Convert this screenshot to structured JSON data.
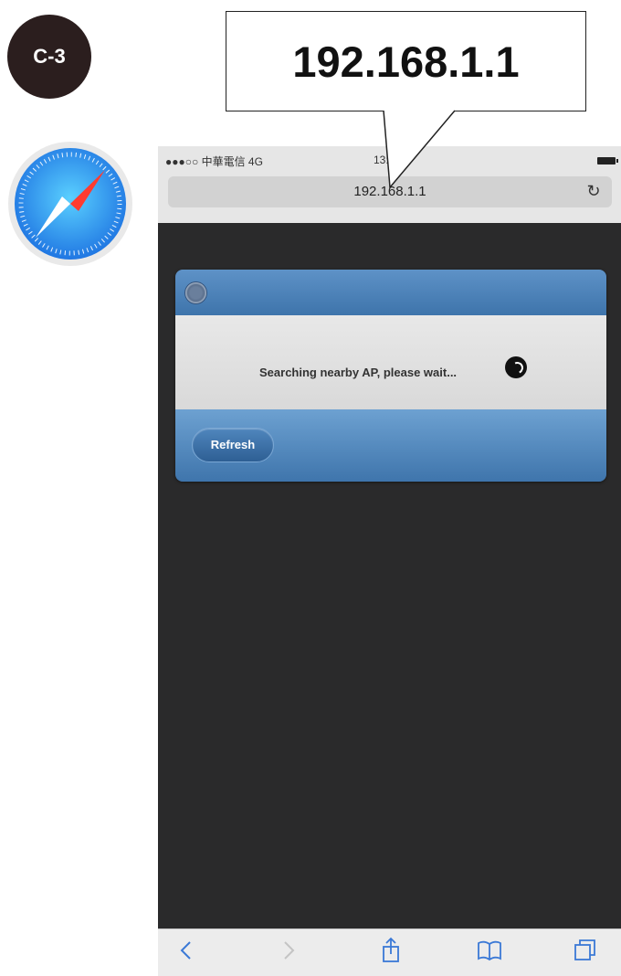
{
  "step_badge": "C-3",
  "callout": {
    "text": "192.168.1.1"
  },
  "status_bar": {
    "carrier": "●●●○○ 中華電信 4G",
    "time": "13:"
  },
  "browser": {
    "url": "192.168.1.1"
  },
  "dialog": {
    "message": "Searching nearby AP, please wait...",
    "refresh_label": "Refresh"
  },
  "icons": {
    "step": "step-badge",
    "app": "safari-icon",
    "reload": "reload-icon",
    "close": "close-icon",
    "spinner": "spinner-icon",
    "back": "back-icon",
    "forward": "forward-icon",
    "share": "share-icon",
    "bookmarks": "bookmarks-icon",
    "tabs": "tabs-icon"
  },
  "colors": {
    "page_background": "#2a2a2b",
    "dialog_blue": "#4f86bd",
    "toolbar_icon": "#3b79d6",
    "badge": "#2b1e1e"
  }
}
